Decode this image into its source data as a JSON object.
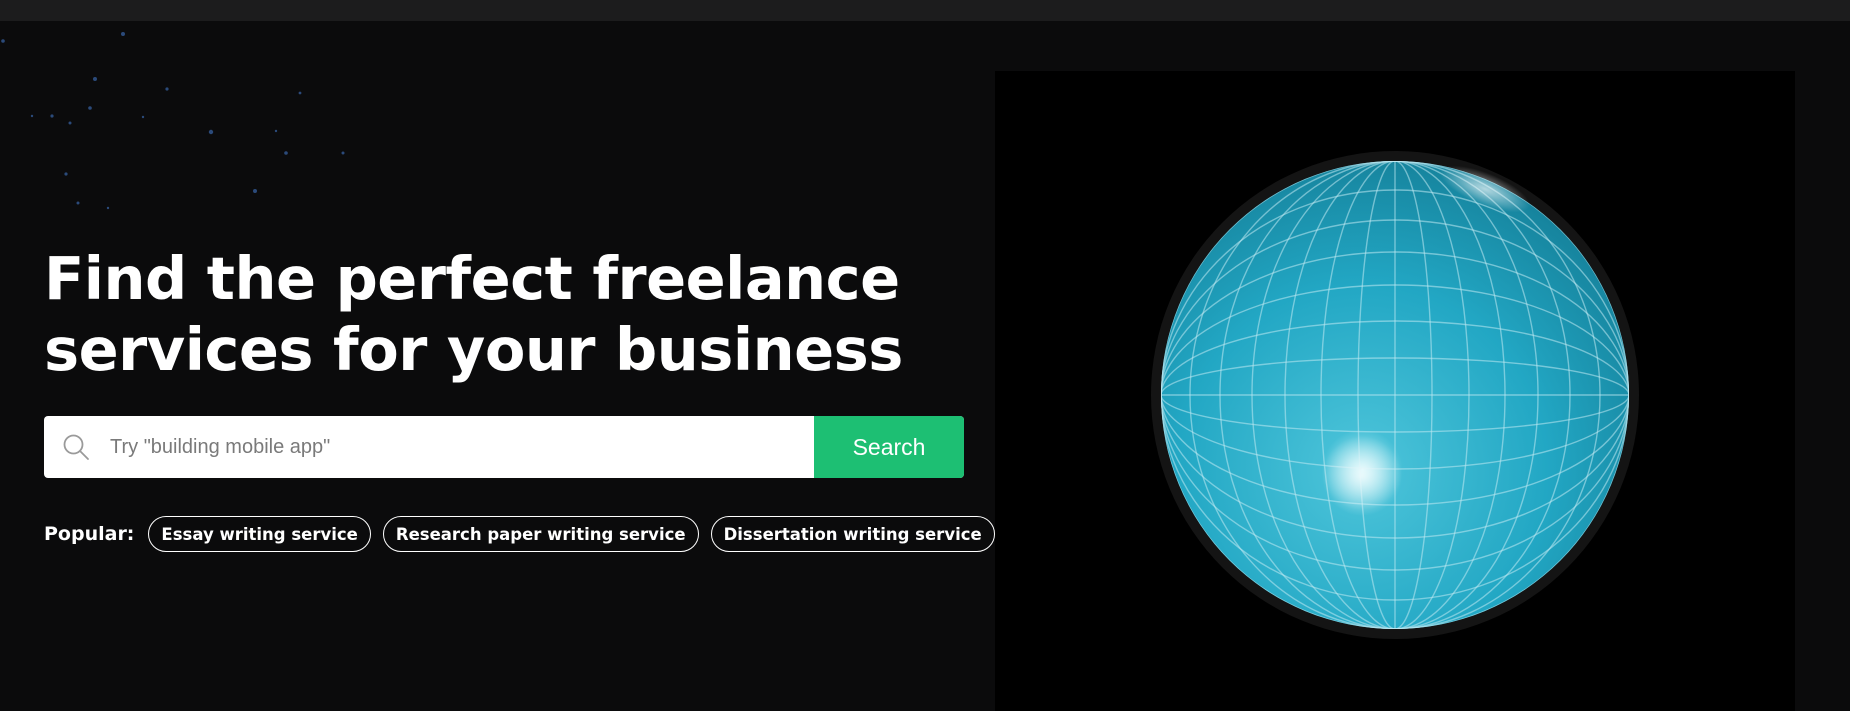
{
  "hero": {
    "title_line1": "Find the perfect freelance",
    "title_line2": "services for your business"
  },
  "search": {
    "placeholder": "Try \"building mobile app\"",
    "button_label": "Search",
    "icon": "search-icon"
  },
  "popular": {
    "label": "Popular:",
    "items": [
      "Essay writing service",
      "Research paper writing service",
      "Dissertation writing service"
    ]
  },
  "media": {
    "icon": "globe-icon"
  },
  "colors": {
    "background": "#0b0b0c",
    "accent": "#1dbf73",
    "globe": "#2aa3c2"
  }
}
